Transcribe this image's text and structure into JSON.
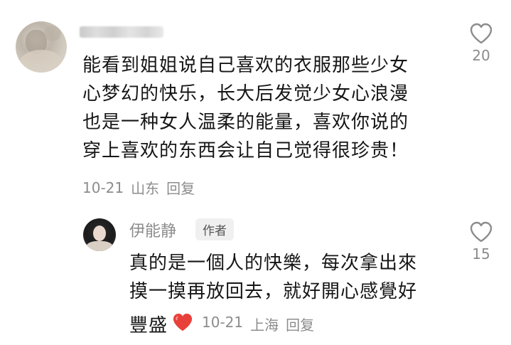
{
  "comment": {
    "lines": [
      "能看到姐姐说自己喜欢的衣服那些少女",
      "心梦幻的快乐，长大后发觉少女心浪漫",
      "也是一种女人温柔的能量，喜欢你说的",
      "穿上喜欢的东西会让自己觉得很珍贵！"
    ],
    "date": "10-21",
    "location": "山东",
    "reply_label": "回复",
    "like_icon": "heart-outline-icon",
    "like_count": "20"
  },
  "reply": {
    "author_name": "伊能静",
    "author_badge": "作者",
    "lines": [
      "真的是一個人的快樂，每次拿出來",
      "摸一摸再放回去，就好開心感覺好"
    ],
    "last_line": "豐盛",
    "emoji": "red-heart-emoji",
    "date": "10-21",
    "location": "上海",
    "reply_label": "回复",
    "like_icon": "heart-outline-icon",
    "like_count": "15"
  },
  "colors": {
    "text": "#161616",
    "muted": "#8c8c8c",
    "badge_bg": "#f0f0f0",
    "heart_red": "#e8413a"
  }
}
